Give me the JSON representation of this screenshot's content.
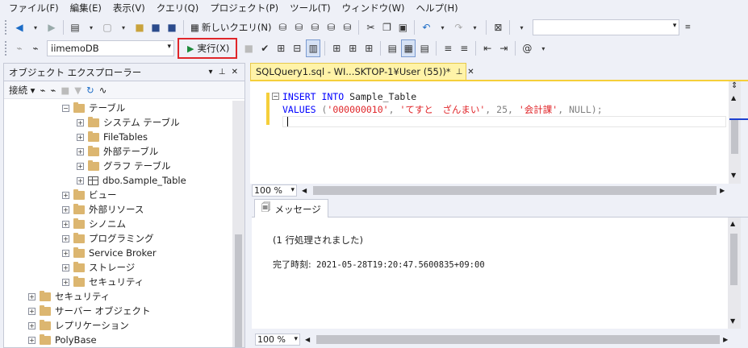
{
  "menu": [
    "ファイル(F)",
    "編集(E)",
    "表示(V)",
    "クエリ(Q)",
    "プロジェクト(P)",
    "ツール(T)",
    "ウィンドウ(W)",
    "ヘルプ(H)"
  ],
  "toolbar": {
    "new_query_label": "新しいクエリ(N)",
    "search_value": ""
  },
  "toolbar2": {
    "database": "iimemoDB",
    "execute_label": "実行(X)"
  },
  "explorer": {
    "title": "オブジェクト エクスプローラー",
    "connect_label": "接続",
    "pin_glyph": "▾ ⊥ ✕",
    "tree": [
      {
        "label": "テーブル",
        "expander": "−",
        "icon": "folder"
      },
      {
        "label": "システム テーブル",
        "expander": "+",
        "icon": "folder"
      },
      {
        "label": "FileTables",
        "expander": "+",
        "icon": "folder"
      },
      {
        "label": "外部テーブル",
        "expander": "+",
        "icon": "folder"
      },
      {
        "label": "グラフ テーブル",
        "expander": "+",
        "icon": "folder"
      },
      {
        "label": "dbo.Sample_Table",
        "expander": "+",
        "icon": "table"
      },
      {
        "label": "ビュー",
        "expander": "+",
        "icon": "folder"
      },
      {
        "label": "外部リソース",
        "expander": "+",
        "icon": "folder"
      },
      {
        "label": "シノニム",
        "expander": "+",
        "icon": "folder"
      },
      {
        "label": "プログラミング",
        "expander": "+",
        "icon": "folder"
      },
      {
        "label": "Service Broker",
        "expander": "+",
        "icon": "folder"
      },
      {
        "label": "ストレージ",
        "expander": "+",
        "icon": "folder"
      },
      {
        "label": "セキュリティ",
        "expander": "+",
        "icon": "folder"
      },
      {
        "label": "セキュリティ",
        "expander": "+",
        "icon": "folder"
      },
      {
        "label": "サーバー オブジェクト",
        "expander": "+",
        "icon": "folder"
      },
      {
        "label": "レプリケーション",
        "expander": "+",
        "icon": "folder"
      },
      {
        "label": "PolyBase",
        "expander": "+",
        "icon": "folder"
      }
    ]
  },
  "editor": {
    "tab_title": "SQLQuery1.sql - WI...SKTOP-1¥User (55))*",
    "tab_pin": "⊥",
    "tab_close": "✕",
    "line1_kw": "INSERT INTO",
    "line1_rest": " Sample_Table",
    "line2_kw": "VALUES",
    "line2_open": " (",
    "line2_str1": "'000000010'",
    "line2_c1": ", ",
    "line2_str2": "'てすと　ざんまい'",
    "line2_num": ", 25, ",
    "line2_str3": "'会計課'",
    "line2_c2": ", ",
    "line2_null": "NULL",
    "line2_close": ");",
    "zoom": "100 %"
  },
  "results": {
    "tab_label": "メッセージ",
    "message1": "(1 行処理されました)",
    "completion_label": "完了時刻:",
    "completion_time": " 2021-05-28T19:20:47.5600835+09:00",
    "zoom": "100 %"
  }
}
